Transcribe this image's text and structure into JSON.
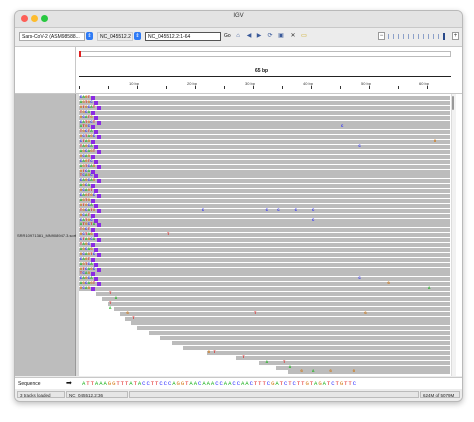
{
  "window": {
    "title": "IGV"
  },
  "toolbar": {
    "genome_value": "Sars-CoV-2 (ASM98588...",
    "chromosome_value": "NC_045512.2",
    "locus_value": "NC_045512.2:1-64",
    "go_label": "Go",
    "icons": [
      "home-icon",
      "back-icon",
      "forward-icon",
      "refresh-icon",
      "roi-icon",
      "close-icon",
      "popup-icon"
    ],
    "zoom_minus": "−",
    "zoom_plus": "+"
  },
  "ruler": {
    "span_label": "65 bp",
    "ticks": [
      "10 bp",
      "20 bp",
      "30 bp",
      "40 bp",
      "50 bp",
      "60 bp"
    ]
  },
  "track": {
    "name": "SRR10971381_MN908947.3.sorted.bam"
  },
  "sequence": {
    "label": "Sequence",
    "arrow": "➡",
    "bases": "ATTAAAGGTTTATACCTTCCCAGGTAACAAACCAACCAACTTTCGATCTCTTGTAGATCTGTTC"
  },
  "status": {
    "tracks_loaded": "3 tracks loaded",
    "position": "NC_045512.2:36",
    "memory": "624M of 5079M"
  },
  "colors": {
    "A": "#1fb41f",
    "C": "#2424ff",
    "G": "#d17105",
    "T": "#e01515",
    "read": "#bcbcbc",
    "softclip": "#8a2be2"
  }
}
